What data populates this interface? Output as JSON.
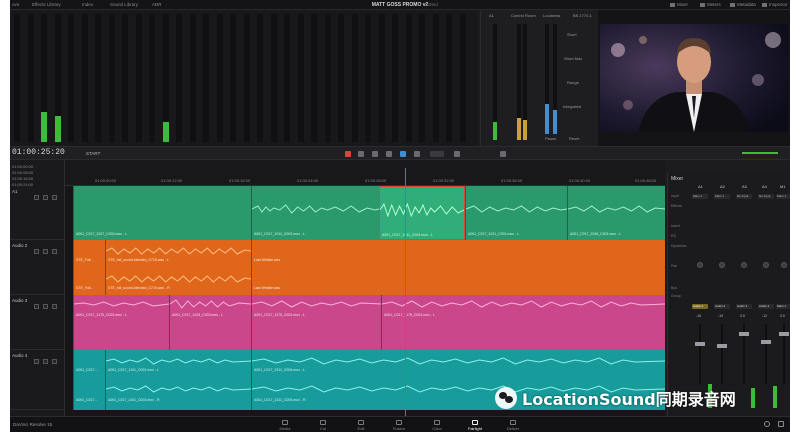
{
  "topbar": {
    "menu_left": [
      "ovo",
      "Effects Library",
      "Index",
      "Sound Library",
      "ADR"
    ],
    "project_title": "MATT GOSS PROMO v2",
    "project_status": "Edited",
    "right_items": [
      "Mixer",
      "Meters",
      "Metadata",
      "Inspector"
    ]
  },
  "loudness": {
    "col1": "A1",
    "col2": "Control Room",
    "col3": "Loudness",
    "col4": "BS.1770-1",
    "labels": [
      "Short",
      "Short Max",
      "Range",
      "Integrated"
    ],
    "btn_pause": "Pause",
    "btn_reset": "Reset"
  },
  "toolbar": {
    "timecode": "01:00:25:20",
    "view_label": "START"
  },
  "ruler": {
    "timecodes": [
      "01:00:00:00",
      "01:00:12:00",
      "01:00:16:00",
      "01:00:24:00",
      "01:00:28:00",
      "01:00:32:00",
      "01:00:36:00",
      "01:00:40:00",
      "01:00:48:00"
    ],
    "left_codes": [
      "01:00:00:00",
      "01:00:08:00",
      "01:00:16:00",
      "01:00:24:00"
    ]
  },
  "tracks": [
    {
      "name": "A1",
      "sub": "Audio 1",
      "level": "2.0",
      "color": "#2a9a6c",
      "clips": [
        "A001_C017_1027_C002.mov - L",
        "A001_C017_1011_C003.mov - L",
        "A001_C017_1011_C004.mov - L",
        "A001_C017_1021_C001.mov - L",
        "A001_C017_1026_C001.mov - L"
      ]
    },
    {
      "name": "Audio 2",
      "sub": "",
      "level": "2.0",
      "color": "#e0661a",
      "clips": [
        "STE_Full...",
        "STE_full_sound-blended_G715.wav - L",
        "Last Whistle.wav",
        "STE_Full...",
        "STE_full_sound-blended_G715.wav - R",
        "Last Whistle.wav"
      ]
    },
    {
      "name": "Audio 3",
      "sub": "",
      "level": "2.0",
      "color": "#c9478a",
      "clips": [
        "A001_C017_1175_C002.mov - L",
        "A001_C017_1203_C003.mov - L",
        "A001_C017_1175_C002.mov - L",
        "A001_C017_1175_C003.mov - L"
      ]
    },
    {
      "name": "Audio 4",
      "sub": "",
      "level": "2.0",
      "color": "#179b9b",
      "clips": [
        "A001_C017...",
        "A001_C017_1101_C002.mov - L",
        "A001_C017_1311_C005.mov - L",
        "A001_C017...",
        "A001_C017_1101_C003.mov - R",
        "A001_C017_1311_C005.mov - R"
      ]
    }
  ],
  "mixer": {
    "title": "Mixer",
    "channels": [
      "A1",
      "A2",
      "A3",
      "A4",
      "M1"
    ],
    "rows": [
      "Input",
      "Effects",
      "Insert",
      "EQ",
      "Dynamics",
      "Pan",
      "Bus",
      "Group"
    ],
    "inputs": [
      "Main 1",
      "Main 1",
      "No Input",
      "No Input",
      "Main 1"
    ],
    "names": [
      "Audio 1",
      "Audio 2",
      "Audio 3",
      "Audio 4",
      "Main 1"
    ],
    "levels": [
      "-16",
      "-19",
      "0.0",
      "-12",
      "0.0"
    ]
  },
  "pagebar": {
    "app_name": "DaVinci Resolve 15",
    "pages": [
      "Media",
      "Cut",
      "Edit",
      "Fusion",
      "Color",
      "Fairlight",
      "Deliver"
    ],
    "active_page": "Fairlight"
  },
  "watermark": {
    "text": "LocationSound同期录音网"
  }
}
